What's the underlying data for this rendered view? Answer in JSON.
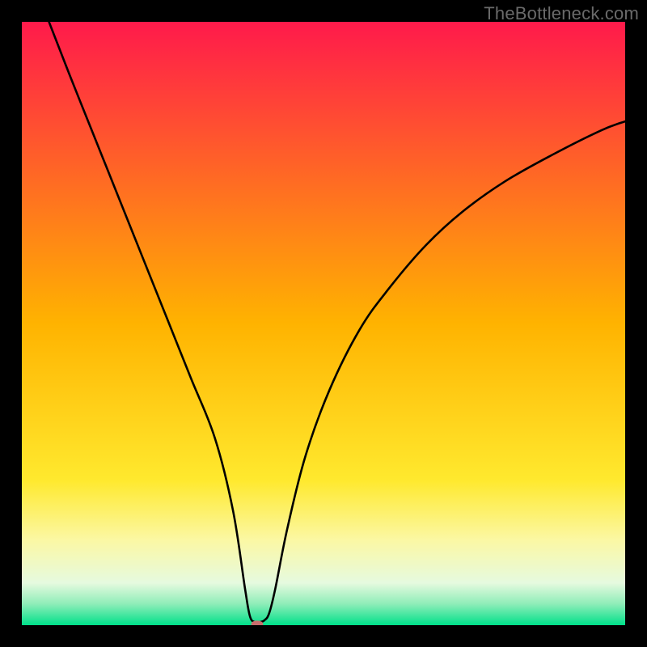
{
  "watermark": "TheBottleneck.com",
  "chart_data": {
    "type": "line",
    "title": "",
    "xlabel": "",
    "ylabel": "",
    "xlim": [
      0,
      100
    ],
    "ylim": [
      0,
      100
    ],
    "grid": false,
    "background_gradient": {
      "stops": [
        {
          "offset": 0.0,
          "color": "#ff1a4b"
        },
        {
          "offset": 0.5,
          "color": "#ffb300"
        },
        {
          "offset": 0.76,
          "color": "#ffe92e"
        },
        {
          "offset": 0.86,
          "color": "#fbf8a5"
        },
        {
          "offset": 0.93,
          "color": "#e6fadf"
        },
        {
          "offset": 0.965,
          "color": "#8eedb8"
        },
        {
          "offset": 1.0,
          "color": "#00e08a"
        }
      ]
    },
    "series": [
      {
        "name": "bottleneck-curve",
        "x": [
          4.5,
          8,
          12,
          16,
          20,
          24,
          28,
          32,
          35,
          37.0,
          37.8,
          38.6,
          39.4,
          40.2,
          41.0,
          42,
          44,
          47,
          51,
          56,
          61,
          67,
          73,
          80,
          88,
          96,
          100
        ],
        "y": [
          100,
          91,
          81,
          71,
          61,
          51,
          41,
          31,
          19,
          6,
          1.5,
          0.5,
          0.5,
          0.8,
          2.0,
          6,
          16,
          28,
          39,
          49,
          56,
          63,
          68.5,
          73.5,
          78,
          82,
          83.5
        ]
      }
    ],
    "marker": {
      "x": 39.0,
      "y": 0.2,
      "rx": 1.0,
      "ry": 0.55,
      "color": "#c96d6d"
    }
  }
}
